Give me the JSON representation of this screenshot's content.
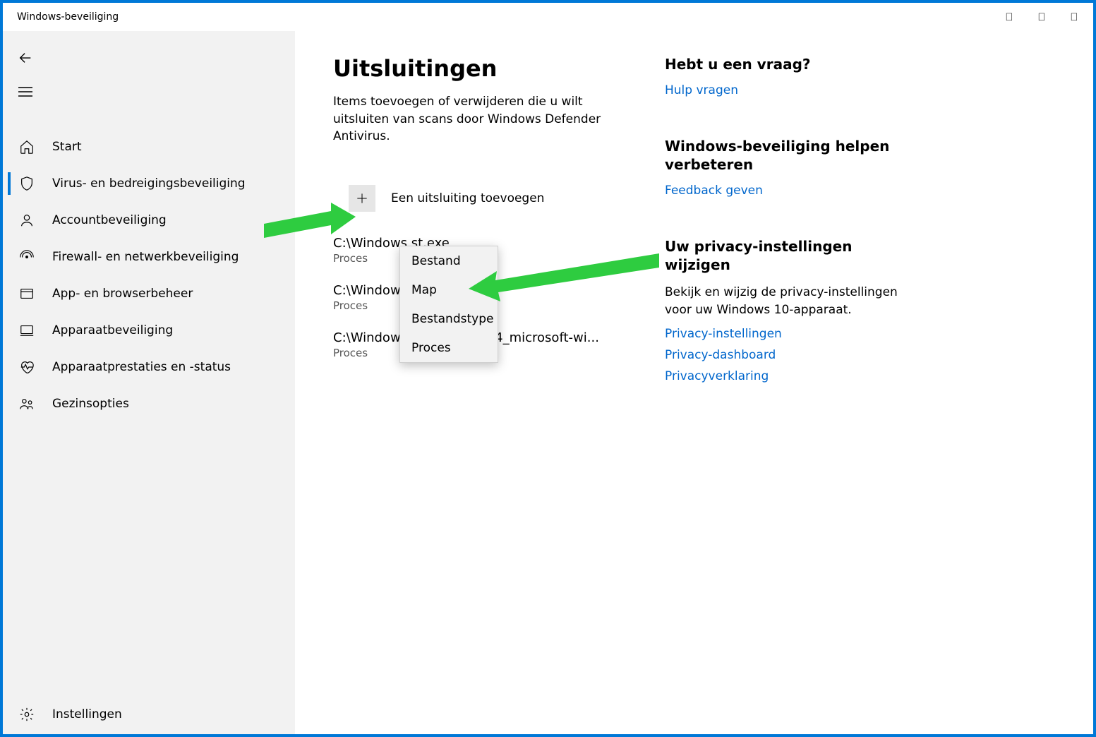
{
  "window": {
    "title": "Windows-beveiliging"
  },
  "sidebar": {
    "items": [
      {
        "label": "Start"
      },
      {
        "label": "Virus- en bedreigingsbeveiliging"
      },
      {
        "label": "Accountbeveiliging"
      },
      {
        "label": "Firewall- en netwerkbeveiliging"
      },
      {
        "label": "App- en browserbeheer"
      },
      {
        "label": "Apparaatbeveiliging"
      },
      {
        "label": "Apparaatprestaties en -status"
      },
      {
        "label": "Gezinsopties"
      }
    ],
    "settings": "Instellingen"
  },
  "page": {
    "title": "Uitsluitingen",
    "description": "Items toevoegen of verwijderen die u wilt uitsluiten van scans door Windows Defender Antivirus.",
    "add_label": "Een uitsluiting toevoegen",
    "exclusions": [
      {
        "path": "C:\\Windows                            st.exe",
        "type": "Proces"
      },
      {
        "path": "C:\\Windows                           clt.exe",
        "type": "Proces"
      },
      {
        "path": "C:\\Windows\\winsxs\\amd64_microsoft-wi...",
        "type": "Proces"
      }
    ]
  },
  "popup": {
    "items": [
      "Bestand",
      "Map",
      "Bestandstype",
      "Proces"
    ]
  },
  "aside": {
    "help": {
      "title": "Hebt u een vraag?",
      "link": "Hulp vragen"
    },
    "improve": {
      "title": "Windows-beveiliging helpen verbeteren",
      "link": "Feedback geven"
    },
    "privacy": {
      "title": "Uw privacy-instellingen wijzigen",
      "text": "Bekijk en wijzig de privacy-instellingen voor uw Windows 10-apparaat.",
      "links": [
        "Privacy-instellingen",
        "Privacy-dashboard",
        "Privacyverklaring"
      ]
    }
  }
}
